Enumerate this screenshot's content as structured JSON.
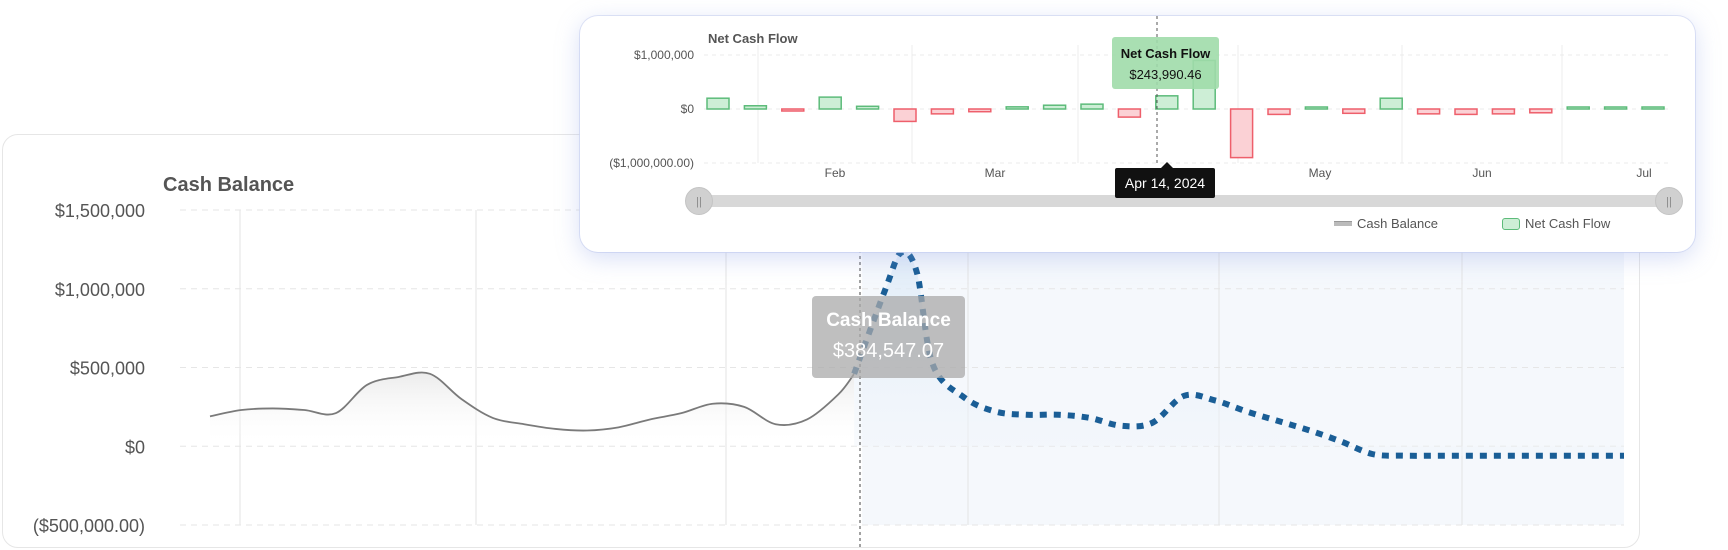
{
  "main": {
    "title": "Cash Balance",
    "tooltip": {
      "title": "Cash Balance",
      "value": "$384,547.07"
    }
  },
  "overlay": {
    "title": "Net Cash Flow",
    "tooltip": {
      "title": "Net Cash Flow",
      "value": "$243,990.46"
    },
    "date_label": "Apr 14, 2024",
    "legend": [
      {
        "label": "Cash Balance",
        "swatch": "line"
      },
      {
        "label": "Net Cash Flow",
        "swatch": "box"
      }
    ],
    "slider_handle_glyph": "||"
  },
  "colors": {
    "positive_fill": "#cdeed6",
    "positive_stroke": "#5dbb7a",
    "negative_fill": "#fbd1d5",
    "negative_stroke": "#ee5f6b",
    "actual_line": "#7a7a7a",
    "forecast_line": "#1a5e96",
    "forecast_fill": "#dbe9f7"
  },
  "chart_data": [
    {
      "type": "line",
      "title": "Cash Balance",
      "y_tick_labels": [
        "$1,500,000",
        "$1,000,000",
        "$500,000",
        "$0",
        "($500,000.00)"
      ],
      "y_ticks": [
        1500000,
        1000000,
        500000,
        0,
        -500000
      ],
      "ylim": [
        -500000,
        1500000
      ],
      "series": [
        {
          "style": "solid",
          "x": [
            0,
            4,
            8,
            12,
            16,
            20,
            24,
            28,
            32,
            36,
            40,
            44,
            48,
            52,
            56,
            60,
            64,
            68,
            72,
            76,
            80,
            82
          ],
          "values": [
            190000,
            230000,
            240000,
            230000,
            210000,
            390000,
            440000,
            460000,
            300000,
            180000,
            140000,
            110000,
            100000,
            120000,
            170000,
            210000,
            270000,
            250000,
            140000,
            170000,
            330000,
            460000
          ]
        },
        {
          "style": "dotted",
          "x": [
            82,
            86,
            88,
            90,
            92,
            96,
            100,
            104,
            108,
            112,
            116,
            120,
            124,
            128,
            132,
            136,
            140,
            144,
            148,
            152,
            156,
            160,
            164,
            168,
            172,
            176,
            180
          ],
          "values": [
            460000,
            1000000,
            1230000,
            1100000,
            520000,
            310000,
            220000,
            200000,
            200000,
            180000,
            130000,
            150000,
            320000,
            290000,
            220000,
            160000,
            100000,
            30000,
            -50000,
            -60000,
            -60000,
            -60000,
            -60000,
            -60000,
            -60000,
            -60000,
            -60000
          ]
        }
      ]
    },
    {
      "type": "bar",
      "title": "Net Cash Flow",
      "y_tick_labels": [
        "$1,000,000",
        "$0",
        "($1,000,000.00)"
      ],
      "y_ticks": [
        1000000,
        0,
        -1000000
      ],
      "ylim": [
        -1000000,
        1000000
      ],
      "x_tick_labels": [
        "Feb",
        "Mar",
        "Apr",
        "May",
        "Jun",
        "Jul"
      ],
      "values": [
        200000,
        60000,
        -30000,
        220000,
        50000,
        -230000,
        -90000,
        -50000,
        40000,
        70000,
        90000,
        -150000,
        243990.46,
        900000,
        -900000,
        -100000,
        0,
        -80000,
        200000,
        -90000,
        -100000,
        -90000,
        -70000,
        0,
        0,
        0
      ]
    }
  ]
}
